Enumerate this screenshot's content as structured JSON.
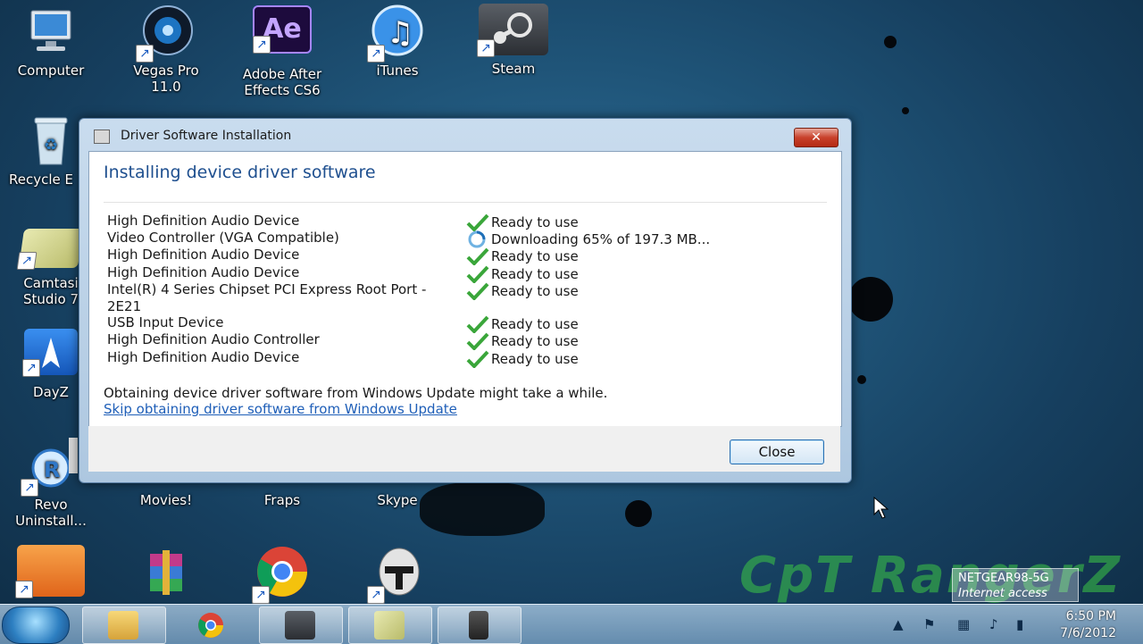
{
  "desktop_icons": [
    {
      "label": "Computer",
      "icon": "computer-icon"
    },
    {
      "label": "Vegas Pro 11.0",
      "icon": "vegas-pro-icon"
    },
    {
      "label": "Adobe After Effects CS6",
      "icon": "after-effects-icon",
      "line1": "Adobe After",
      "line2": "Effects CS6"
    },
    {
      "label": "iTunes",
      "icon": "itunes-icon"
    },
    {
      "label": "Steam",
      "icon": "steam-icon"
    },
    {
      "label": "Recycle E",
      "icon": "recycle-bin-icon"
    },
    {
      "label": "Camtasi Studio 7",
      "icon": "camtasia-icon",
      "line1": "Camtasi",
      "line2": "Studio 7"
    },
    {
      "label": "DayZ",
      "icon": "dayz-icon"
    },
    {
      "label": "Revo Uninstall...",
      "icon": "revo-uninstaller-icon",
      "line1": "Revo",
      "line2": "Uninstall..."
    },
    {
      "label": "Movies!",
      "icon": "movies-icon"
    },
    {
      "label": "Fraps",
      "icon": "fraps-icon"
    },
    {
      "label": "Skype",
      "icon": "skype-icon"
    },
    {
      "label": "",
      "icon": "app-orange-icon"
    },
    {
      "label": "",
      "icon": "winrar-icon"
    },
    {
      "label": "",
      "icon": "chrome-icon"
    },
    {
      "label": "",
      "icon": "clone-trooper-icon"
    }
  ],
  "dialog": {
    "title": "Driver Software Installation",
    "close_glyph": "✕",
    "heading": "Installing device driver software",
    "devices": [
      {
        "name": "High Definition Audio Device",
        "status": "Ready to use",
        "state": "ready"
      },
      {
        "name": "Video Controller (VGA Compatible)",
        "status": "Downloading 65% of 197.3 MB...",
        "state": "downloading"
      },
      {
        "name": "High Definition Audio Device",
        "status": "Ready to use",
        "state": "ready"
      },
      {
        "name": "High Definition Audio Device",
        "status": "Ready to use",
        "state": "ready"
      },
      {
        "name": "Intel(R) 4 Series Chipset PCI Express Root Port - 2E21",
        "name_line1": "Intel(R) 4 Series Chipset PCI Express Root Port -",
        "name_line2": "2E21",
        "status": "Ready to use",
        "state": "ready"
      },
      {
        "name": "USB Input Device",
        "status": "Ready to use",
        "state": "ready"
      },
      {
        "name": "High Definition Audio Controller",
        "status": "Ready to use",
        "state": "ready"
      },
      {
        "name": "High Definition Audio Device",
        "status": "Ready to use",
        "state": "ready"
      }
    ],
    "note": "Obtaining device driver software from Windows Update might take a while.",
    "skip_link": "Skip obtaining driver software from Windows Update",
    "close_button": "Close"
  },
  "watermark": "CpT RangerZ",
  "network": {
    "name": "NETGEAR98-5G",
    "status": "Internet access"
  },
  "taskbar": {
    "pinned": [
      "windows-explorer-icon",
      "chrome-icon",
      "steam-icon",
      "camtasia-icon",
      "camcorder-icon"
    ]
  },
  "clock": {
    "time": "6:50 PM",
    "date": "7/6/2012"
  },
  "colors": {
    "heading": "#1e4f8f",
    "link": "#1f5fb8",
    "check": "#3aa63a",
    "watermark": "#3cc846"
  }
}
